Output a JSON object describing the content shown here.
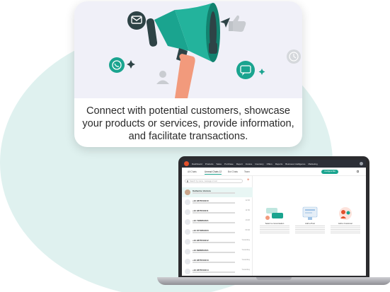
{
  "promo": {
    "text": "Connect with potential customers, showcase your products or services, provide information, and facilitate transactions."
  },
  "icons": [
    "megaphone-icon",
    "mail-icon",
    "whatsapp-icon",
    "thumbs-up-icon",
    "chat-icon",
    "clock-icon",
    "user-icon",
    "sparkle-icon"
  ],
  "colors": {
    "accent": "#1aa48f",
    "brand": "#e2502b",
    "topbar": "#2c2f38",
    "blob": "#dff1ef"
  },
  "app": {
    "nav": [
      "Dashboard",
      "Products",
      "Sales",
      "Purchase",
      "Report",
      "Invoice",
      "Inventory",
      "Offers",
      "Reports",
      "Business Intelligence",
      "Marketing"
    ],
    "tabs": {
      "all": "All Chats",
      "unread": "Unread Chats 12",
      "bot": "Bot Chats",
      "team": "Team"
    },
    "bot_button": "Configure Bot",
    "search_placeholder": "Search by name, message or text",
    "chats": [
      {
        "title": "Katherine Ventura",
        "time": "12:45"
      },
      {
        "title": "+91 9876543210",
        "time": "12:30"
      },
      {
        "title": "+91 9876543211",
        "time": "11:50"
      },
      {
        "title": "+91 7988652321",
        "time": "10:20"
      },
      {
        "title": "+91 8779652223",
        "time": "09:40"
      },
      {
        "title": "+91 9876543212",
        "time": "Yesterday"
      },
      {
        "title": "+91 8988652321",
        "time": "Yesterday"
      },
      {
        "title": "+91 9876543213",
        "time": "Yesterday"
      },
      {
        "title": "+91 9876543214",
        "time": "Yesterday"
      }
    ],
    "features": [
      {
        "title": "Select a conversation"
      },
      {
        "title": "Add a Post"
      },
      {
        "title": "Add a Customer"
      }
    ]
  }
}
